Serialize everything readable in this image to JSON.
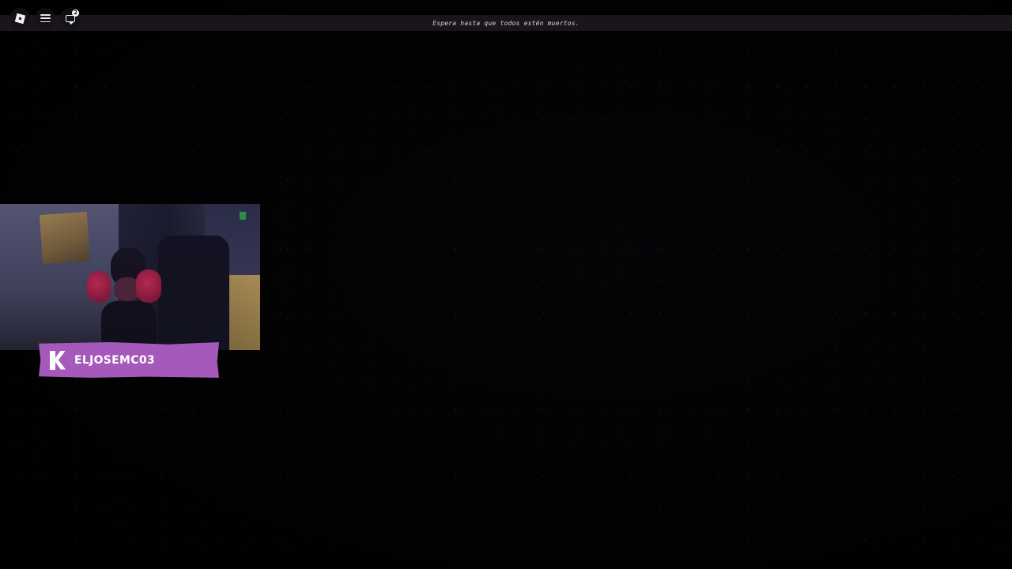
{
  "topbar": {
    "message": "Espera hasta que todos estén muertos."
  },
  "corner_buttons": {
    "roblox_icon": "roblox-logo-icon",
    "menu_icon": "hamburger-menu-icon",
    "chat_icon": "chat-icon",
    "chat_badge_count": "2"
  },
  "webcam_overlay": {
    "streamer_name": "ELJOSEMC03",
    "banner_logo": "kick-logo",
    "banner_color": "#a559ba"
  },
  "colors": {
    "background": "#000000",
    "topbar_bg": "#1c141d",
    "topbar_text": "#d8d0d8"
  }
}
